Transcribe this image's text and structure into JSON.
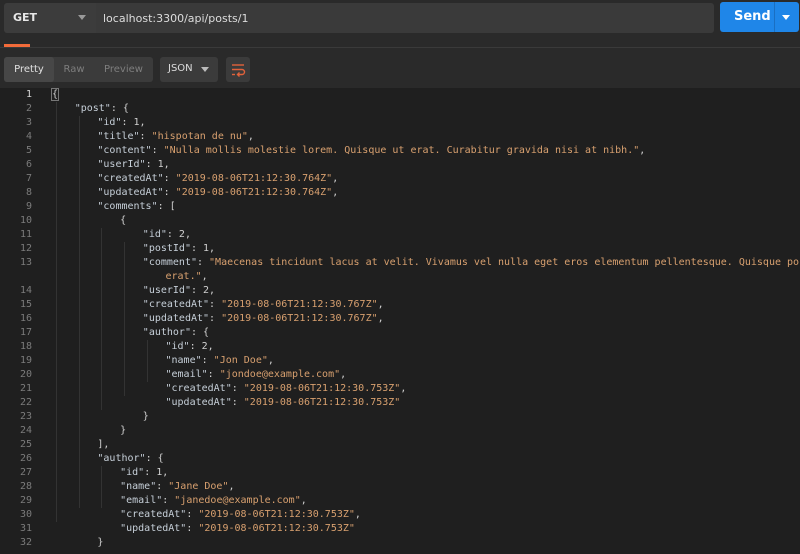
{
  "request": {
    "method": "GET",
    "url": "localhost:3300/api/posts/1",
    "send_label": "Send"
  },
  "response_toolbar": {
    "views": [
      "Pretty",
      "Raw",
      "Preview"
    ],
    "active_view": "Pretty",
    "format": "JSON"
  },
  "code_lines": [
    {
      "n": "1",
      "i": 0,
      "t": [
        [
          "p",
          "{"
        ]
      ]
    },
    {
      "n": "2",
      "i": 1,
      "t": [
        [
          "k",
          "\"post\""
        ],
        [
          "p",
          ": {"
        ]
      ]
    },
    {
      "n": "3",
      "i": 2,
      "t": [
        [
          "k",
          "\"id\""
        ],
        [
          "p",
          ": 1,"
        ]
      ]
    },
    {
      "n": "4",
      "i": 2,
      "t": [
        [
          "k",
          "\"title\""
        ],
        [
          "p",
          ": "
        ],
        [
          "s",
          "\"hispotan de nu\""
        ],
        [
          "p",
          ","
        ]
      ]
    },
    {
      "n": "5",
      "i": 2,
      "t": [
        [
          "k",
          "\"content\""
        ],
        [
          "p",
          ": "
        ],
        [
          "s",
          "\"Nulla mollis molestie lorem. Quisque ut erat. Curabitur gravida nisi at nibh.\""
        ],
        [
          "p",
          ","
        ]
      ]
    },
    {
      "n": "6",
      "i": 2,
      "t": [
        [
          "k",
          "\"userId\""
        ],
        [
          "p",
          ": 1,"
        ]
      ]
    },
    {
      "n": "7",
      "i": 2,
      "t": [
        [
          "k",
          "\"createdAt\""
        ],
        [
          "p",
          ": "
        ],
        [
          "s",
          "\"2019-08-06T21:12:30.764Z\""
        ],
        [
          "p",
          ","
        ]
      ]
    },
    {
      "n": "8",
      "i": 2,
      "t": [
        [
          "k",
          "\"updatedAt\""
        ],
        [
          "p",
          ": "
        ],
        [
          "s",
          "\"2019-08-06T21:12:30.764Z\""
        ],
        [
          "p",
          ","
        ]
      ]
    },
    {
      "n": "9",
      "i": 2,
      "t": [
        [
          "k",
          "\"comments\""
        ],
        [
          "p",
          ": ["
        ]
      ]
    },
    {
      "n": "10",
      "i": 3,
      "t": [
        [
          "p",
          "{"
        ]
      ]
    },
    {
      "n": "11",
      "i": 4,
      "t": [
        [
          "k",
          "\"id\""
        ],
        [
          "p",
          ": 2,"
        ]
      ]
    },
    {
      "n": "12",
      "i": 4,
      "t": [
        [
          "k",
          "\"postId\""
        ],
        [
          "p",
          ": 1,"
        ]
      ]
    },
    {
      "n": "13",
      "i": 4,
      "t": [
        [
          "k",
          "\"comment\""
        ],
        [
          "p",
          ": "
        ],
        [
          "s",
          "\"Maecenas tincidunt lacus at velit. Vivamus vel nulla eget eros elementum pellentesque. Quisque porta volu"
        ]
      ]
    },
    {
      "n": "",
      "i": 5,
      "t": [
        [
          "s",
          "erat.\""
        ],
        [
          "p",
          ","
        ]
      ]
    },
    {
      "n": "14",
      "i": 4,
      "t": [
        [
          "k",
          "\"userId\""
        ],
        [
          "p",
          ": 2,"
        ]
      ]
    },
    {
      "n": "15",
      "i": 4,
      "t": [
        [
          "k",
          "\"createdAt\""
        ],
        [
          "p",
          ": "
        ],
        [
          "s",
          "\"2019-08-06T21:12:30.767Z\""
        ],
        [
          "p",
          ","
        ]
      ]
    },
    {
      "n": "16",
      "i": 4,
      "t": [
        [
          "k",
          "\"updatedAt\""
        ],
        [
          "p",
          ": "
        ],
        [
          "s",
          "\"2019-08-06T21:12:30.767Z\""
        ],
        [
          "p",
          ","
        ]
      ]
    },
    {
      "n": "17",
      "i": 4,
      "t": [
        [
          "k",
          "\"author\""
        ],
        [
          "p",
          ": {"
        ]
      ]
    },
    {
      "n": "18",
      "i": 5,
      "t": [
        [
          "k",
          "\"id\""
        ],
        [
          "p",
          ": 2,"
        ]
      ]
    },
    {
      "n": "19",
      "i": 5,
      "t": [
        [
          "k",
          "\"name\""
        ],
        [
          "p",
          ": "
        ],
        [
          "s",
          "\"Jon Doe\""
        ],
        [
          "p",
          ","
        ]
      ]
    },
    {
      "n": "20",
      "i": 5,
      "t": [
        [
          "k",
          "\"email\""
        ],
        [
          "p",
          ": "
        ],
        [
          "s",
          "\"jondoe@example.com\""
        ],
        [
          "p",
          ","
        ]
      ]
    },
    {
      "n": "21",
      "i": 5,
      "t": [
        [
          "k",
          "\"createdAt\""
        ],
        [
          "p",
          ": "
        ],
        [
          "s",
          "\"2019-08-06T21:12:30.753Z\""
        ],
        [
          "p",
          ","
        ]
      ]
    },
    {
      "n": "22",
      "i": 5,
      "t": [
        [
          "k",
          "\"updatedAt\""
        ],
        [
          "p",
          ": "
        ],
        [
          "s",
          "\"2019-08-06T21:12:30.753Z\""
        ]
      ]
    },
    {
      "n": "23",
      "i": 4,
      "t": [
        [
          "p",
          "}"
        ]
      ]
    },
    {
      "n": "24",
      "i": 3,
      "t": [
        [
          "p",
          "}"
        ]
      ]
    },
    {
      "n": "25",
      "i": 2,
      "t": [
        [
          "p",
          "],"
        ]
      ]
    },
    {
      "n": "26",
      "i": 2,
      "t": [
        [
          "k",
          "\"author\""
        ],
        [
          "p",
          ": {"
        ]
      ]
    },
    {
      "n": "27",
      "i": 3,
      "t": [
        [
          "k",
          "\"id\""
        ],
        [
          "p",
          ": 1,"
        ]
      ]
    },
    {
      "n": "28",
      "i": 3,
      "t": [
        [
          "k",
          "\"name\""
        ],
        [
          "p",
          ": "
        ],
        [
          "s",
          "\"Jane Doe\""
        ],
        [
          "p",
          ","
        ]
      ]
    },
    {
      "n": "29",
      "i": 3,
      "t": [
        [
          "k",
          "\"email\""
        ],
        [
          "p",
          ": "
        ],
        [
          "s",
          "\"janedoe@example.com\""
        ],
        [
          "p",
          ","
        ]
      ]
    },
    {
      "n": "30",
      "i": 3,
      "t": [
        [
          "k",
          "\"createdAt\""
        ],
        [
          "p",
          ": "
        ],
        [
          "s",
          "\"2019-08-06T21:12:30.753Z\""
        ],
        [
          "p",
          ","
        ]
      ]
    },
    {
      "n": "31",
      "i": 3,
      "t": [
        [
          "k",
          "\"updatedAt\""
        ],
        [
          "p",
          ": "
        ],
        [
          "s",
          "\"2019-08-06T21:12:30.753Z\""
        ]
      ]
    },
    {
      "n": "32",
      "i": 2,
      "t": [
        [
          "p",
          "}"
        ]
      ]
    }
  ]
}
